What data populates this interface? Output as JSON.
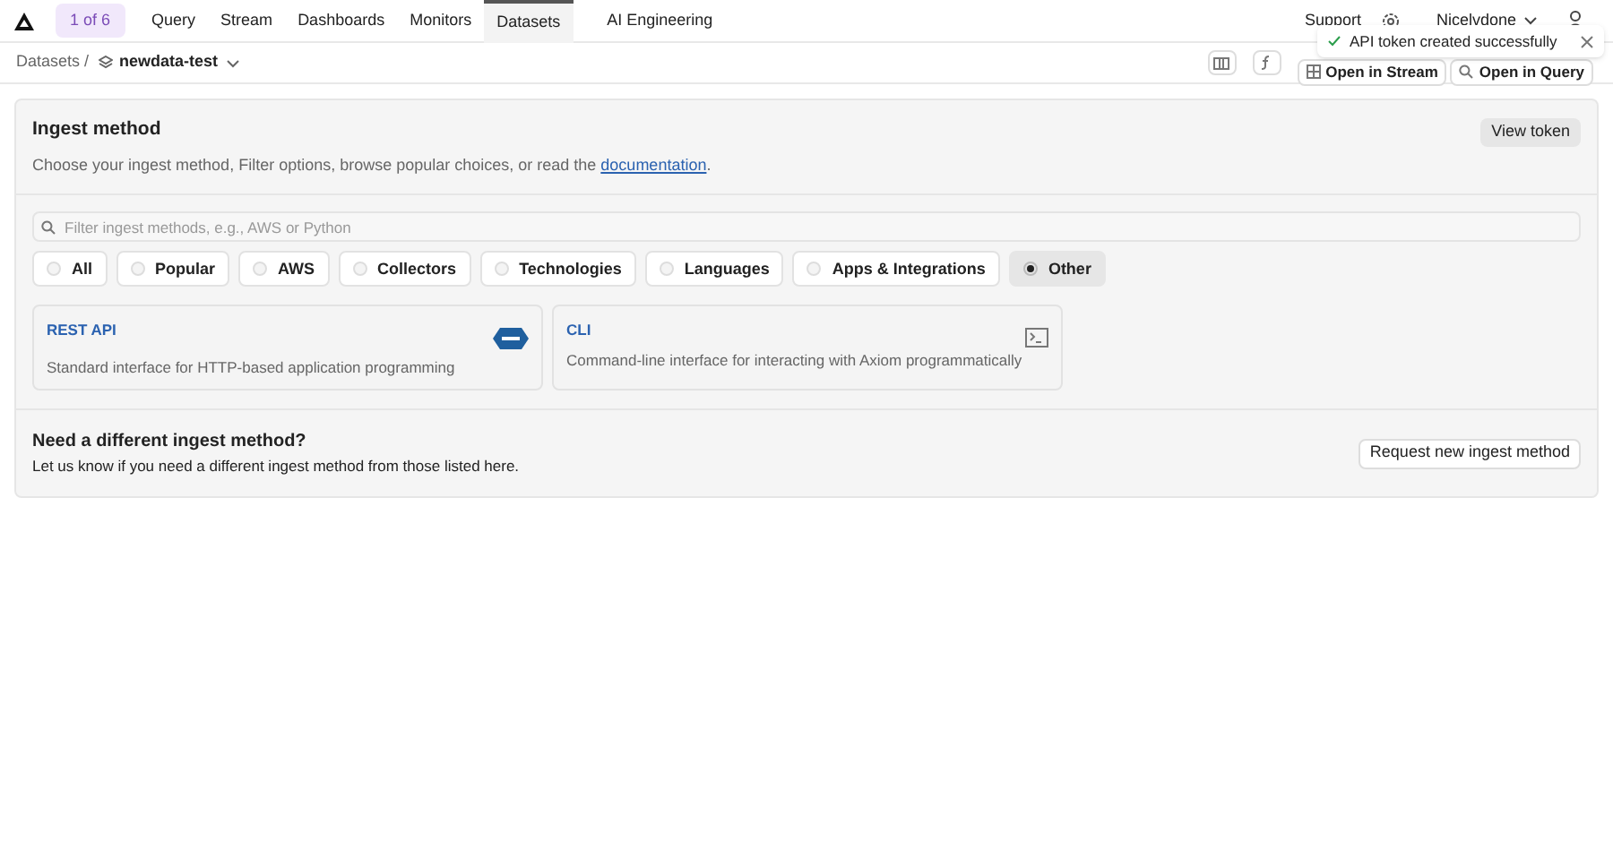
{
  "nav": {
    "counter": "1 of 6",
    "tabs": [
      {
        "label": "Query",
        "selected": false
      },
      {
        "label": "Stream",
        "selected": false
      },
      {
        "label": "Dashboards",
        "selected": false
      },
      {
        "label": "Monitors",
        "selected": false
      },
      {
        "label": "Datasets",
        "selected": true
      },
      {
        "label": "AI Engineering",
        "selected": false
      }
    ],
    "support": "Support",
    "user": "Nicelvdone"
  },
  "toast": {
    "message": "API token created successfully"
  },
  "breadcrumb": {
    "root": "Datasets /",
    "dataset": "newdata-test"
  },
  "actions": [
    "Open in Stream",
    "Open in Query"
  ],
  "ingest": {
    "title": "Ingest method",
    "description": "Choose your ingest method, Filter options, browse popular choices, or read the ",
    "link": "documentation",
    "link_after": ".",
    "view_token": "View token",
    "search": {
      "placeholder": "Filter ingest methods, e.g., AWS or Python"
    },
    "filters": [
      {
        "label": "All",
        "selected": false
      },
      {
        "label": "Popular",
        "selected": false
      },
      {
        "label": "AWS",
        "selected": false
      },
      {
        "label": "Collectors",
        "selected": false
      },
      {
        "label": "Technologies",
        "selected": false
      },
      {
        "label": "Languages",
        "selected": false
      },
      {
        "label": "Apps & Integrations",
        "selected": false
      },
      {
        "label": "Other",
        "selected": true
      }
    ],
    "methods": [
      {
        "name": "REST API",
        "description": "Standard interface for HTTP-based application programming",
        "kind": "http"
      },
      {
        "name": "CLI",
        "description": "Command-line interface for interacting with Axiom programmatically",
        "kind": "terminal"
      }
    ]
  },
  "different": {
    "title": "Need a different ingest method?",
    "description": "Let us know if you need a different ingest method from those listed here.",
    "button": "Request new ingest method"
  }
}
